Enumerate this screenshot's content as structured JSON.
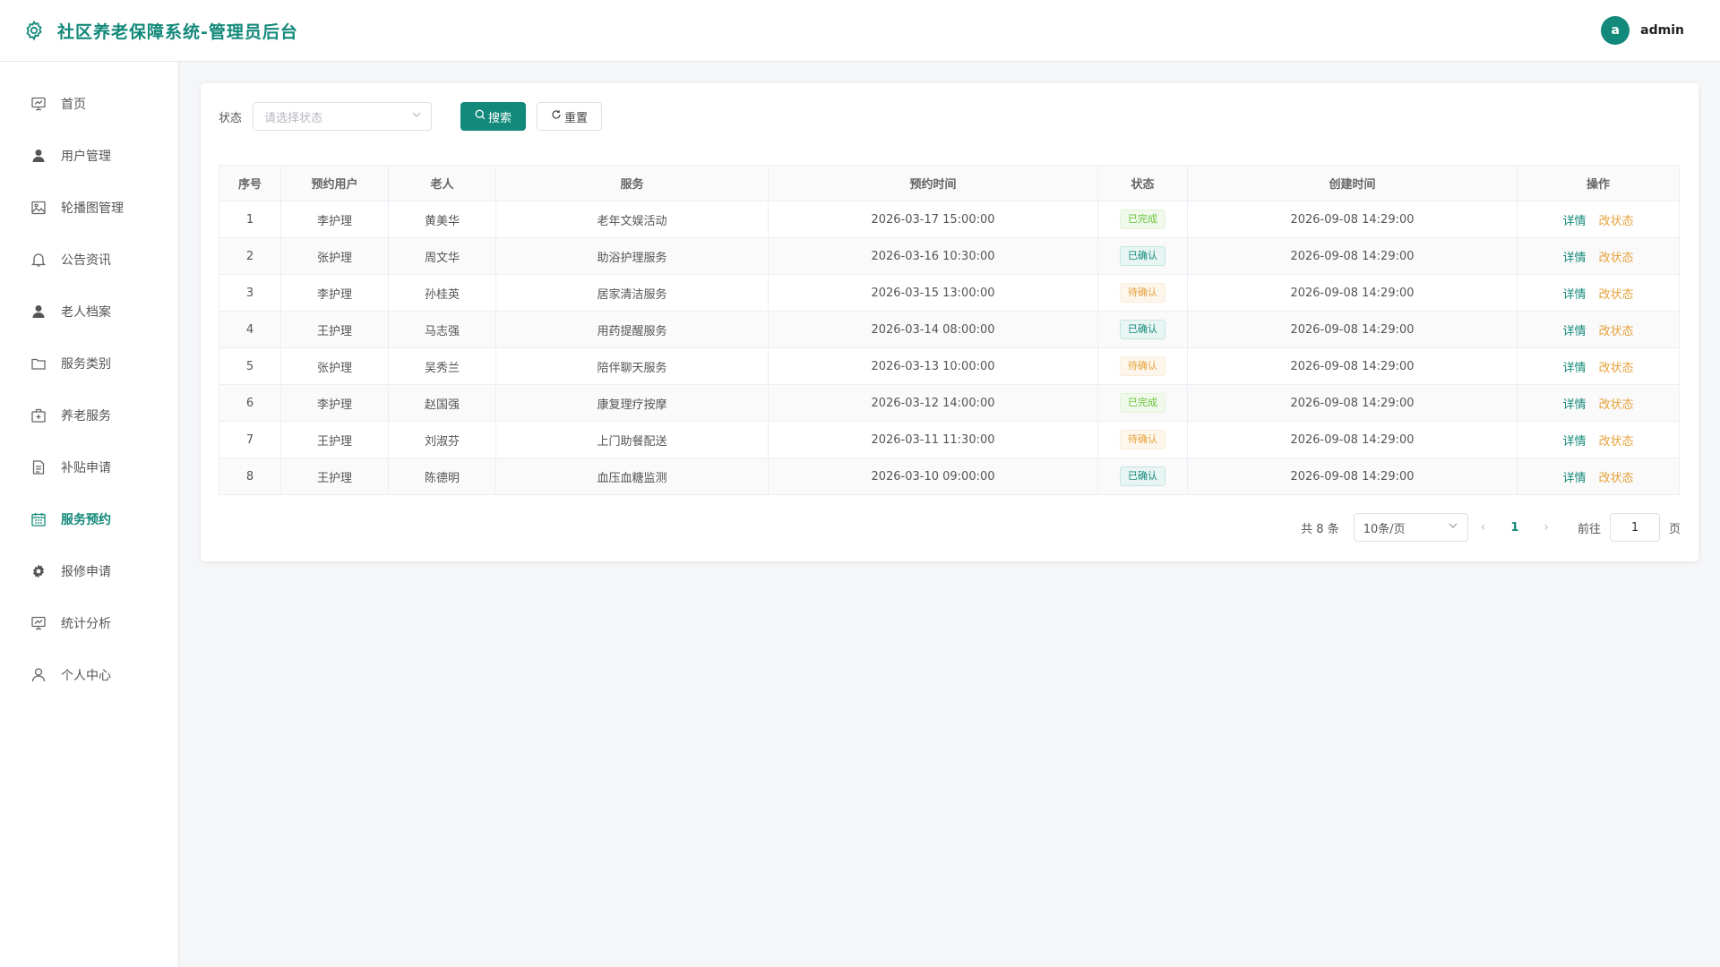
{
  "header": {
    "title": "社区养老保障系统-管理员后台",
    "avatar_letter": "a",
    "username": "admin"
  },
  "sidebar": {
    "items": [
      {
        "label": "首页",
        "icon": "chart-board-icon"
      },
      {
        "label": "用户管理",
        "icon": "user-filled-icon"
      },
      {
        "label": "轮播图管理",
        "icon": "picture-icon"
      },
      {
        "label": "公告资讯",
        "icon": "bell-icon"
      },
      {
        "label": "老人档案",
        "icon": "user-filled-icon"
      },
      {
        "label": "服务类别",
        "icon": "folder-icon"
      },
      {
        "label": "养老服务",
        "icon": "first-aid-kit-icon"
      },
      {
        "label": "补贴申请",
        "icon": "document-icon"
      },
      {
        "label": "服务预约",
        "icon": "calendar-icon"
      },
      {
        "label": "报修申请",
        "icon": "gear-icon"
      },
      {
        "label": "统计分析",
        "icon": "chart-board-icon"
      },
      {
        "label": "个人中心",
        "icon": "user-icon"
      }
    ],
    "active_index": 8
  },
  "filter": {
    "label": "状态",
    "placeholder": "请选择状态",
    "search_label": "搜索",
    "reset_label": "重置"
  },
  "table": {
    "columns": [
      "序号",
      "预约用户",
      "老人",
      "服务",
      "预约时间",
      "状态",
      "创建时间",
      "操作"
    ],
    "rows": [
      {
        "no": "1",
        "user": "李护理",
        "elder": "黄美华",
        "service": "老年文娱活动",
        "time": "2026-03-17 15:00:00",
        "status": "已完成",
        "status_type": "done",
        "created": "2026-09-08 14:29:00"
      },
      {
        "no": "2",
        "user": "张护理",
        "elder": "周文华",
        "service": "助浴护理服务",
        "time": "2026-03-16 10:30:00",
        "status": "已确认",
        "status_type": "confirmed",
        "created": "2026-09-08 14:29:00"
      },
      {
        "no": "3",
        "user": "李护理",
        "elder": "孙桂英",
        "service": "居家清洁服务",
        "time": "2026-03-15 13:00:00",
        "status": "待确认",
        "status_type": "pending",
        "created": "2026-09-08 14:29:00"
      },
      {
        "no": "4",
        "user": "王护理",
        "elder": "马志强",
        "service": "用药提醒服务",
        "time": "2026-03-14 08:00:00",
        "status": "已确认",
        "status_type": "confirmed",
        "created": "2026-09-08 14:29:00"
      },
      {
        "no": "5",
        "user": "张护理",
        "elder": "吴秀兰",
        "service": "陪伴聊天服务",
        "time": "2026-03-13 10:00:00",
        "status": "待确认",
        "status_type": "pending",
        "created": "2026-09-08 14:29:00"
      },
      {
        "no": "6",
        "user": "李护理",
        "elder": "赵国强",
        "service": "康复理疗按摩",
        "time": "2026-03-12 14:00:00",
        "status": "已完成",
        "status_type": "done",
        "created": "2026-09-08 14:29:00"
      },
      {
        "no": "7",
        "user": "王护理",
        "elder": "刘淑芬",
        "service": "上门助餐配送",
        "time": "2026-03-11 11:30:00",
        "status": "待确认",
        "status_type": "pending",
        "created": "2026-09-08 14:29:00"
      },
      {
        "no": "8",
        "user": "王护理",
        "elder": "陈德明",
        "service": "血压血糖监测",
        "time": "2026-03-10 09:00:00",
        "status": "已确认",
        "status_type": "confirmed",
        "created": "2026-09-08 14:29:00"
      }
    ],
    "op_detail": "详情",
    "op_status": "改状态"
  },
  "pagination": {
    "total_text": "共 8 条",
    "page_size": "10条/页",
    "current_page": "1",
    "goto_label": "前往",
    "goto_value": "1",
    "page_suffix": "页"
  },
  "colors": {
    "accent": "#12897a",
    "warning": "#e6a23c",
    "success": "#67c23a"
  }
}
